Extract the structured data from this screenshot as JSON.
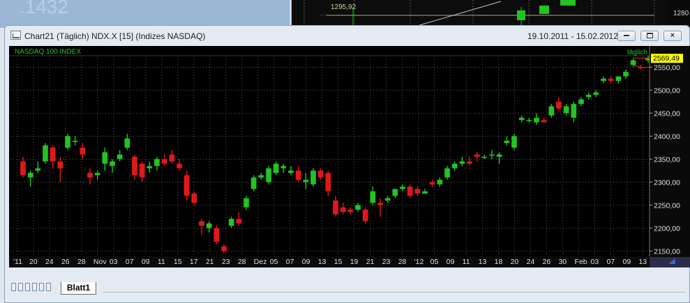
{
  "window": {
    "title": "Chart21 (Täglich)  NDX.X [15] (Indizes NASDAQ)",
    "date_range": "19.10.2011 - 15.02.2012",
    "buttons": {
      "minimize": "minimize",
      "restore": "restore",
      "close": "close"
    }
  },
  "background": {
    "ghost_text": ".1432",
    "value_left": "1295,92",
    "value_right": "1280"
  },
  "sheet": {
    "tab_label": "Blatt1"
  },
  "colors": {
    "up": "#22c322",
    "down": "#e01818",
    "grid": "#6a6a6a",
    "axis_bg": "#0a0a0a",
    "last_price_bg": "#ffff00",
    "header_text": "#22c322"
  },
  "chart_data": {
    "type": "candlestick",
    "title": "NASDAQ 100 INDEX",
    "period_label": "täglich",
    "last_price": "2569,49",
    "y_ticks": [
      {
        "value": 2550,
        "label": "2550,00"
      },
      {
        "value": 2500,
        "label": "2500,00"
      },
      {
        "value": 2450,
        "label": "2450,00"
      },
      {
        "value": 2400,
        "label": "2400,00"
      },
      {
        "value": 2350,
        "label": "2350,00"
      },
      {
        "value": 2300,
        "label": "2300,00"
      },
      {
        "value": 2250,
        "label": "2250,00"
      },
      {
        "value": 2200,
        "label": "2200,00"
      },
      {
        "value": 2150,
        "label": "2150,00"
      }
    ],
    "ylim": [
      2140,
      2584
    ],
    "x_labels": [
      {
        "index": 0,
        "label": "'11"
      },
      {
        "index": 1,
        "label": "20"
      },
      {
        "index": 2,
        "label": "24"
      },
      {
        "index": 3,
        "label": "26"
      },
      {
        "index": 4,
        "label": "28"
      },
      {
        "index": 5,
        "label": "Nov"
      },
      {
        "index": 6,
        "label": "03"
      },
      {
        "index": 7,
        "label": "07"
      },
      {
        "index": 8,
        "label": "09"
      },
      {
        "index": 9,
        "label": "11"
      },
      {
        "index": 10,
        "label": "15"
      },
      {
        "index": 11,
        "label": "17"
      },
      {
        "index": 12,
        "label": "21"
      },
      {
        "index": 13,
        "label": "23"
      },
      {
        "index": 14,
        "label": "28"
      },
      {
        "index": 15,
        "label": "Dez"
      },
      {
        "index": 16,
        "label": "05"
      },
      {
        "index": 17,
        "label": "07"
      },
      {
        "index": 18,
        "label": "09"
      },
      {
        "index": 19,
        "label": "13"
      },
      {
        "index": 20,
        "label": "15"
      },
      {
        "index": 21,
        "label": "19"
      },
      {
        "index": 22,
        "label": "21"
      },
      {
        "index": 23,
        "label": "23"
      },
      {
        "index": 24,
        "label": "28"
      },
      {
        "index": 25,
        "label": "'12"
      },
      {
        "index": 26,
        "label": "05"
      },
      {
        "index": 27,
        "label": "09"
      },
      {
        "index": 28,
        "label": "11"
      },
      {
        "index": 29,
        "label": "13"
      },
      {
        "index": 30,
        "label": "18"
      },
      {
        "index": 31,
        "label": "20"
      },
      {
        "index": 32,
        "label": "24"
      },
      {
        "index": 33,
        "label": "26"
      },
      {
        "index": 34,
        "label": "30"
      },
      {
        "index": 35,
        "label": "Feb"
      },
      {
        "index": 36,
        "label": "03"
      },
      {
        "index": 37,
        "label": "07"
      },
      {
        "index": 38,
        "label": "09"
      },
      {
        "index": 39,
        "label": "13"
      }
    ],
    "candles": [
      {
        "o": 2345,
        "h": 2355,
        "l": 2310,
        "c": 2315
      },
      {
        "o": 2310,
        "h": 2325,
        "l": 2290,
        "c": 2320
      },
      {
        "o": 2325,
        "h": 2345,
        "l": 2320,
        "c": 2330
      },
      {
        "o": 2345,
        "h": 2385,
        "l": 2340,
        "c": 2380
      },
      {
        "o": 2375,
        "h": 2380,
        "l": 2330,
        "c": 2345
      },
      {
        "o": 2345,
        "h": 2355,
        "l": 2300,
        "c": 2330
      },
      {
        "o": 2375,
        "h": 2405,
        "l": 2370,
        "c": 2400
      },
      {
        "o": 2390,
        "h": 2400,
        "l": 2380,
        "c": 2390
      },
      {
        "o": 2375,
        "h": 2385,
        "l": 2350,
        "c": 2360
      },
      {
        "o": 2320,
        "h": 2330,
        "l": 2295,
        "c": 2310
      },
      {
        "o": 2315,
        "h": 2325,
        "l": 2305,
        "c": 2320
      },
      {
        "o": 2340,
        "h": 2375,
        "l": 2325,
        "c": 2365
      },
      {
        "o": 2335,
        "h": 2350,
        "l": 2320,
        "c": 2345
      },
      {
        "o": 2350,
        "h": 2370,
        "l": 2345,
        "c": 2360
      },
      {
        "o": 2375,
        "h": 2405,
        "l": 2370,
        "c": 2395
      },
      {
        "o": 2355,
        "h": 2360,
        "l": 2305,
        "c": 2315
      },
      {
        "o": 2340,
        "h": 2345,
        "l": 2300,
        "c": 2310
      },
      {
        "o": 2330,
        "h": 2345,
        "l": 2320,
        "c": 2335
      },
      {
        "o": 2335,
        "h": 2355,
        "l": 2325,
        "c": 2350
      },
      {
        "o": 2350,
        "h": 2360,
        "l": 2335,
        "c": 2340
      },
      {
        "o": 2360,
        "h": 2370,
        "l": 2340,
        "c": 2345
      },
      {
        "o": 2340,
        "h": 2350,
        "l": 2325,
        "c": 2330
      },
      {
        "o": 2315,
        "h": 2325,
        "l": 2260,
        "c": 2270
      },
      {
        "o": 2275,
        "h": 2280,
        "l": 2250,
        "c": 2255
      },
      {
        "o": 2215,
        "h": 2220,
        "l": 2185,
        "c": 2205
      },
      {
        "o": 2200,
        "h": 2215,
        "l": 2190,
        "c": 2210
      },
      {
        "o": 2200,
        "h": 2205,
        "l": 2165,
        "c": 2170
      },
      {
        "o": 2160,
        "h": 2165,
        "l": 2145,
        "c": 2150
      },
      {
        "o": 2205,
        "h": 2225,
        "l": 2200,
        "c": 2220
      },
      {
        "o": 2220,
        "h": 2235,
        "l": 2205,
        "c": 2210
      },
      {
        "o": 2245,
        "h": 2270,
        "l": 2240,
        "c": 2265
      },
      {
        "o": 2285,
        "h": 2315,
        "l": 2280,
        "c": 2310
      },
      {
        "o": 2310,
        "h": 2320,
        "l": 2305,
        "c": 2315
      },
      {
        "o": 2300,
        "h": 2335,
        "l": 2295,
        "c": 2330
      },
      {
        "o": 2320,
        "h": 2345,
        "l": 2315,
        "c": 2340
      },
      {
        "o": 2330,
        "h": 2340,
        "l": 2320,
        "c": 2335
      },
      {
        "o": 2320,
        "h": 2335,
        "l": 2315,
        "c": 2325
      },
      {
        "o": 2325,
        "h": 2335,
        "l": 2300,
        "c": 2305
      },
      {
        "o": 2300,
        "h": 2320,
        "l": 2285,
        "c": 2305
      },
      {
        "o": 2295,
        "h": 2330,
        "l": 2290,
        "c": 2325
      },
      {
        "o": 2325,
        "h": 2330,
        "l": 2305,
        "c": 2310
      },
      {
        "o": 2320,
        "h": 2325,
        "l": 2270,
        "c": 2280
      },
      {
        "o": 2260,
        "h": 2270,
        "l": 2225,
        "c": 2230
      },
      {
        "o": 2245,
        "h": 2255,
        "l": 2230,
        "c": 2235
      },
      {
        "o": 2240,
        "h": 2245,
        "l": 2230,
        "c": 2235
      },
      {
        "o": 2240,
        "h": 2255,
        "l": 2235,
        "c": 2250
      },
      {
        "o": 2240,
        "h": 2245,
        "l": 2210,
        "c": 2215
      },
      {
        "o": 2255,
        "h": 2290,
        "l": 2250,
        "c": 2280
      },
      {
        "o": 2255,
        "h": 2265,
        "l": 2225,
        "c": 2250
      },
      {
        "o": 2260,
        "h": 2270,
        "l": 2255,
        "c": 2265
      },
      {
        "o": 2270,
        "h": 2285,
        "l": 2265,
        "c": 2285
      },
      {
        "o": 2285,
        "h": 2295,
        "l": 2280,
        "c": 2290
      },
      {
        "o": 2290,
        "h": 2295,
        "l": 2265,
        "c": 2270
      },
      {
        "o": 2285,
        "h": 2290,
        "l": 2270,
        "c": 2275
      },
      {
        "o": 2275,
        "h": 2285,
        "l": 2275,
        "c": 2280
      },
      {
        "o": 2300,
        "h": 2305,
        "l": 2290,
        "c": 2295
      },
      {
        "o": 2295,
        "h": 2310,
        "l": 2290,
        "c": 2305
      },
      {
        "o": 2310,
        "h": 2335,
        "l": 2305,
        "c": 2330
      },
      {
        "o": 2330,
        "h": 2345,
        "l": 2325,
        "c": 2340
      },
      {
        "o": 2340,
        "h": 2355,
        "l": 2335,
        "c": 2345
      },
      {
        "o": 2345,
        "h": 2355,
        "l": 2335,
        "c": 2340
      },
      {
        "o": 2360,
        "h": 2365,
        "l": 2345,
        "c": 2355
      },
      {
        "o": 2355,
        "h": 2360,
        "l": 2350,
        "c": 2355
      },
      {
        "o": 2360,
        "h": 2370,
        "l": 2350,
        "c": 2360
      },
      {
        "o": 2355,
        "h": 2365,
        "l": 2340,
        "c": 2360
      },
      {
        "o": 2385,
        "h": 2400,
        "l": 2380,
        "c": 2390
      },
      {
        "o": 2375,
        "h": 2405,
        "l": 2370,
        "c": 2400
      },
      {
        "o": 2435,
        "h": 2445,
        "l": 2430,
        "c": 2440
      },
      {
        "o": 2435,
        "h": 2440,
        "l": 2430,
        "c": 2435
      },
      {
        "o": 2430,
        "h": 2450,
        "l": 2425,
        "c": 2440
      },
      {
        "o": 2435,
        "h": 2440,
        "l": 2430,
        "c": 2430
      },
      {
        "o": 2445,
        "h": 2470,
        "l": 2440,
        "c": 2465
      },
      {
        "o": 2475,
        "h": 2485,
        "l": 2455,
        "c": 2460
      },
      {
        "o": 2450,
        "h": 2470,
        "l": 2445,
        "c": 2465
      },
      {
        "o": 2440,
        "h": 2475,
        "l": 2430,
        "c": 2470
      },
      {
        "o": 2470,
        "h": 2485,
        "l": 2465,
        "c": 2480
      },
      {
        "o": 2485,
        "h": 2495,
        "l": 2480,
        "c": 2490
      },
      {
        "o": 2490,
        "h": 2500,
        "l": 2485,
        "c": 2495
      },
      {
        "o": 2520,
        "h": 2530,
        "l": 2515,
        "c": 2525
      },
      {
        "o": 2525,
        "h": 2530,
        "l": 2515,
        "c": 2520
      },
      {
        "o": 2520,
        "h": 2530,
        "l": 2515,
        "c": 2530
      },
      {
        "o": 2530,
        "h": 2545,
        "l": 2525,
        "c": 2540
      },
      {
        "o": 2555,
        "h": 2570,
        "l": 2550,
        "c": 2565
      },
      {
        "o": 2550,
        "h": 2555,
        "l": 2545,
        "c": 2548
      },
      {
        "o": 2565,
        "h": 2575,
        "l": 2560,
        "c": 2570
      }
    ],
    "grid": true,
    "legend": "none"
  }
}
